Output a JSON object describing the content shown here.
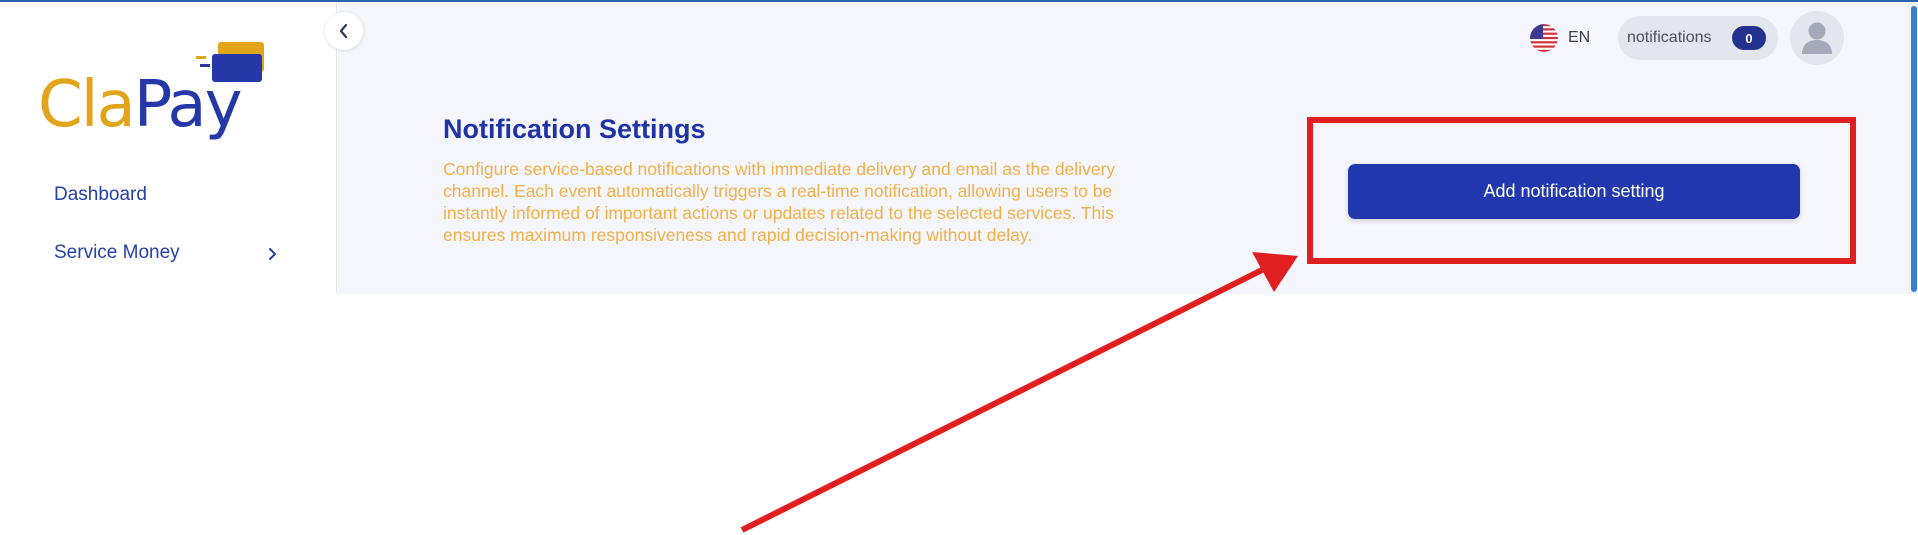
{
  "app": {
    "logo_text_part1": "Cla",
    "logo_text_part2": "Pay"
  },
  "sidebar": {
    "items": [
      {
        "label": "Dashboard",
        "icon": "",
        "has_submenu": false
      },
      {
        "label": "Service Money",
        "icon": "chevron-right-icon",
        "has_submenu": true
      }
    ]
  },
  "header": {
    "language": {
      "code": "EN",
      "flag": "us-flag-icon"
    },
    "notifications": {
      "label": "notifications",
      "count": "0"
    },
    "avatar": "user-avatar-icon"
  },
  "main": {
    "title": "Notification Settings",
    "description": "Configure service-based notifications with immediate delivery and email as the delivery channel. Each event automatically triggers a real-time notification, allowing users to be instantly informed of important actions or updates related to the selected services. This ensures maximum responsiveness and rapid decision-making without delay.",
    "add_button_label": "Add notification setting"
  },
  "colors": {
    "primary": "#2138ae",
    "accent_orange": "#f2b048",
    "logo_yellow": "#e2a418",
    "annotation_red": "#e02020",
    "background": "#f5f6fb"
  }
}
